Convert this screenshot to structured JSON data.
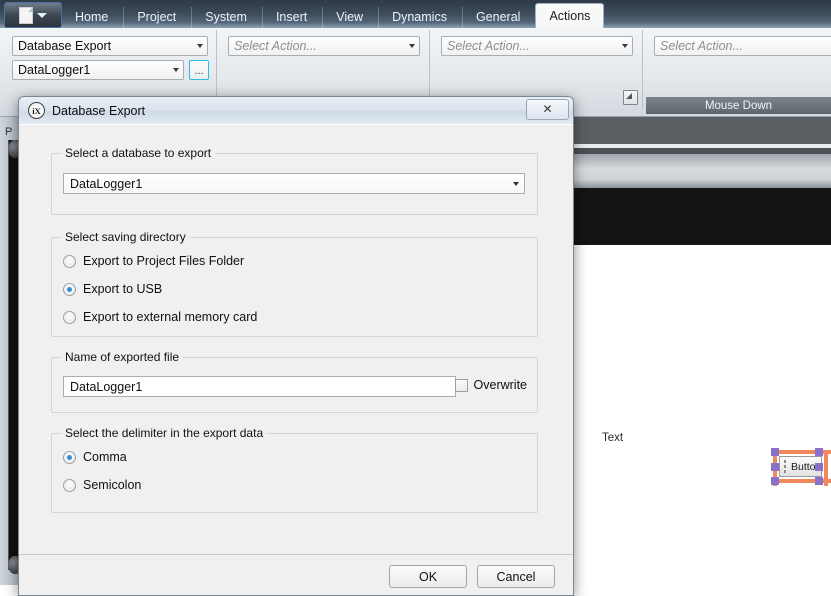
{
  "app": {
    "app_button_icon": "document-dropdown-icon",
    "tabs": [
      {
        "label": "Home",
        "active": false
      },
      {
        "label": "Project",
        "active": false
      },
      {
        "label": "System",
        "active": false
      },
      {
        "label": "Insert",
        "active": false
      },
      {
        "label": "View",
        "active": false
      },
      {
        "label": "Dynamics",
        "active": false
      },
      {
        "label": "General",
        "active": false
      },
      {
        "label": "Actions",
        "active": true
      }
    ],
    "ribbon": {
      "group1": {
        "action_value": "Database Export",
        "target_value": "DataLogger1",
        "browse_label": "..."
      },
      "group2": {
        "placeholder": "Select Action..."
      },
      "group3": {
        "placeholder": "Select Action..."
      },
      "group4": {
        "placeholder": "Select Action..."
      },
      "mouse_down_label": "Mouse Down"
    },
    "left_panel_char": "P",
    "canvas": {
      "text_object": "Text",
      "button_object": "Button"
    }
  },
  "dialog": {
    "icon": "ix-logo-icon",
    "title": "Database Export",
    "close_label": "✕",
    "sections": {
      "database": {
        "legend": "Select a database to export",
        "selected": "DataLogger1"
      },
      "directory": {
        "legend": "Select saving directory",
        "options": [
          {
            "label": "Export to Project Files Folder",
            "selected": false
          },
          {
            "label": "Export to USB",
            "selected": true
          },
          {
            "label": "Export to external memory card",
            "selected": false
          }
        ]
      },
      "filename": {
        "legend": "Name of exported file",
        "value": "DataLogger1",
        "overwrite_label": "Overwrite",
        "overwrite_checked": false
      },
      "delimiter": {
        "legend": "Select the delimiter in the export data",
        "options": [
          {
            "label": "Comma",
            "selected": true
          },
          {
            "label": "Semicolon",
            "selected": false
          }
        ]
      }
    },
    "footer": {
      "ok_label": "OK",
      "cancel_label": "Cancel"
    }
  },
  "colors": {
    "accent_blue": "#2f8fd6",
    "browse_highlight": "#2fb8e6",
    "selection_bar": "#f08a5d",
    "selection_handle": "#8a70c8",
    "ribbon_tab_bg": "#3c4a58"
  }
}
